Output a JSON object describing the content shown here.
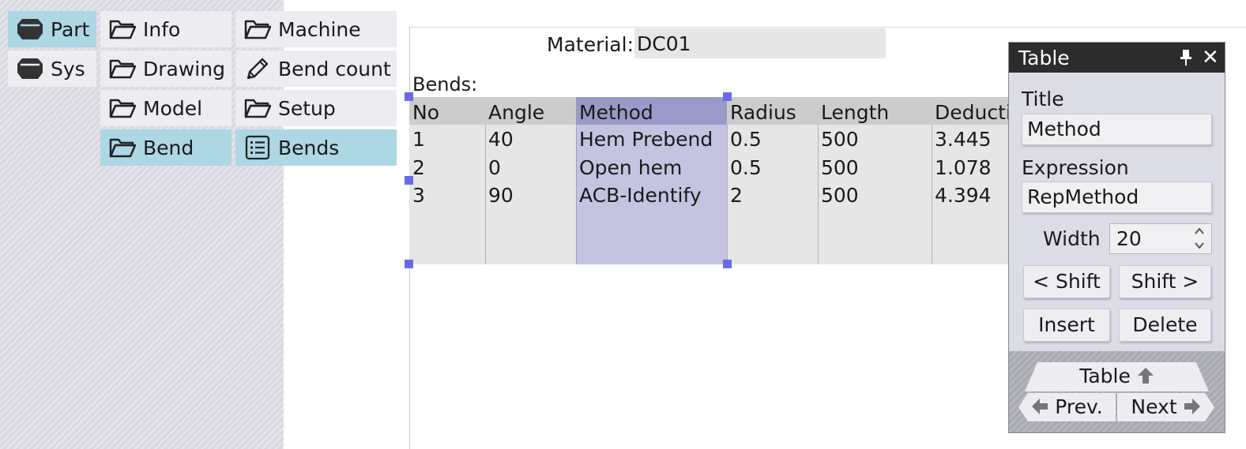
{
  "nav": {
    "part": "Part",
    "sys": "Sys",
    "info": "Info",
    "machine": "Machine",
    "drawing": "Drawing",
    "bend_count": "Bend count",
    "model": "Model",
    "setup": "Setup",
    "bend": "Bend",
    "bends": "Bends"
  },
  "sheet": {
    "material_label": "Material:",
    "material_value": "DC01",
    "bends_label": "Bends:"
  },
  "table": {
    "headers": [
      "No",
      "Angle",
      "Method",
      "Radius",
      "Length",
      "Deducti"
    ],
    "rows": [
      [
        "1",
        "40",
        "Hem Prebend",
        "0.5",
        "500",
        "3.445"
      ],
      [
        "2",
        "0",
        "Open hem",
        "0.5",
        "500",
        "1.078"
      ],
      [
        "3",
        "90",
        "ACB-Identify",
        "2",
        "500",
        "4.394"
      ]
    ]
  },
  "panel": {
    "title": "Table",
    "close": "✕",
    "title_label": "Title",
    "title_value": "Method",
    "expression_label": "Expression",
    "expression_value": "RepMethod",
    "width_label": "Width",
    "width_value": "20",
    "shift_left": "< Shift",
    "shift_right": "Shift >",
    "insert": "Insert",
    "delete": "Delete",
    "nav_table": "Table",
    "nav_prev": "Prev.",
    "nav_next": "Next"
  },
  "colors": {
    "active_nav": "#acd7e3",
    "selection": "#c9c9ec",
    "handle": "#6a6ae6",
    "titlebar": "#2c2c2c"
  }
}
